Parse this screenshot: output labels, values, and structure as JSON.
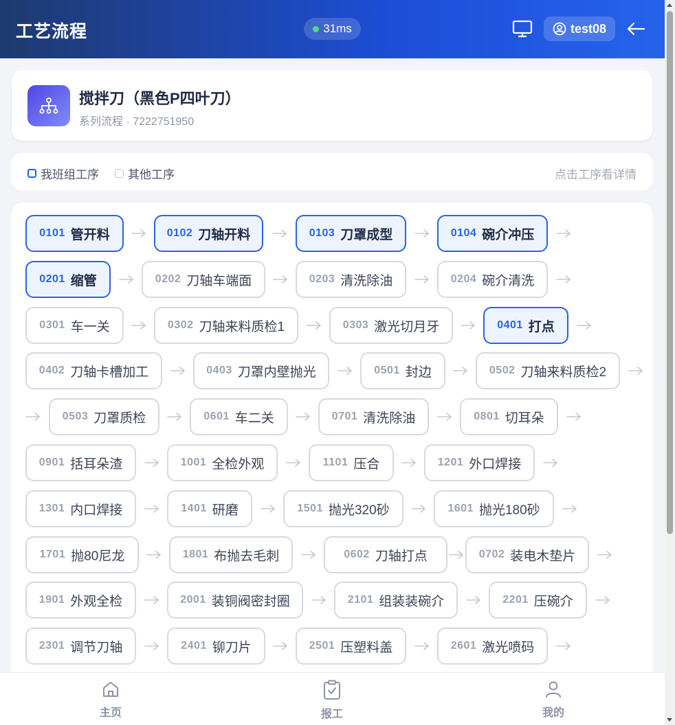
{
  "header": {
    "title": "工艺流程",
    "latency": "31ms",
    "user": "test08"
  },
  "product": {
    "name": "搅拌刀（黑色P四叶刀）",
    "subtitle": "系列流程 · 7222751950"
  },
  "legend": {
    "mine": "我班组工序",
    "other": "其他工序",
    "hint": "点击工序看详情"
  },
  "colors": {
    "accent": "#2563eb",
    "mine_bg": "#eef4ff",
    "other_border": "#d6d9e1",
    "latency_dot": "#4ade80"
  },
  "flow": [
    {
      "code": "0101",
      "name": "管开料",
      "mine": true
    },
    {
      "code": "0102",
      "name": "刀轴开料",
      "mine": true
    },
    {
      "code": "0103",
      "name": "刀罩成型",
      "mine": true
    },
    {
      "code": "0104",
      "name": "碗介冲压",
      "mine": true
    },
    {
      "code": "0201",
      "name": "缩管",
      "mine": true
    },
    {
      "code": "0202",
      "name": "刀轴车端面",
      "mine": false
    },
    {
      "code": "0203",
      "name": "清洗除油",
      "mine": false
    },
    {
      "code": "0204",
      "name": "碗介清洗",
      "mine": false
    },
    {
      "code": "0301",
      "name": "车一关",
      "mine": false
    },
    {
      "code": "0302",
      "name": "刀轴来料质检1",
      "mine": false
    },
    {
      "code": "0303",
      "name": "激光切月牙",
      "mine": false
    },
    {
      "code": "0401",
      "name": "打点",
      "mine": true
    },
    {
      "code": "0402",
      "name": "刀轴卡槽加工",
      "mine": false
    },
    {
      "code": "0403",
      "name": "刀罩内壁抛光",
      "mine": false
    },
    {
      "code": "0501",
      "name": "封边",
      "mine": false
    },
    {
      "code": "0502",
      "name": "刀轴来料质检2",
      "mine": false
    },
    {
      "code": "0503",
      "name": "刀罩质检",
      "mine": false
    },
    {
      "code": "0601",
      "name": "车二关",
      "mine": false
    },
    {
      "code": "0701",
      "name": "清洗除油",
      "mine": false
    },
    {
      "code": "0801",
      "name": "切耳朵",
      "mine": false
    },
    {
      "code": "0901",
      "name": "括耳朵渣",
      "mine": false
    },
    {
      "code": "1001",
      "name": "全检外观",
      "mine": false
    },
    {
      "code": "1101",
      "name": "压合",
      "mine": false
    },
    {
      "code": "1201",
      "name": "外口焊接",
      "mine": false
    },
    {
      "code": "1301",
      "name": "内口焊接",
      "mine": false
    },
    {
      "code": "1401",
      "name": "研磨",
      "mine": false
    },
    {
      "code": "1501",
      "name": "抛光320砂",
      "mine": false
    },
    {
      "code": "1601",
      "name": "抛光180砂",
      "mine": false
    },
    {
      "code": "1701",
      "name": "抛80尼龙",
      "mine": false
    },
    {
      "code": "1801",
      "name": "布抛去毛刺",
      "mine": false
    },
    {
      "code": "0602",
      "name": "刀轴打点",
      "mine": false
    },
    {
      "code": "0702",
      "name": "装电木垫片",
      "mine": false
    },
    {
      "code": "1901",
      "name": "外观全检",
      "mine": false
    },
    {
      "code": "2001",
      "name": "装铜阀密封圈",
      "mine": false
    },
    {
      "code": "2101",
      "name": "组装装碗介",
      "mine": false
    },
    {
      "code": "2201",
      "name": "压碗介",
      "mine": false
    },
    {
      "code": "2301",
      "name": "调节刀轴",
      "mine": false
    },
    {
      "code": "2401",
      "name": "铆刀片",
      "mine": false
    },
    {
      "code": "2501",
      "name": "压塑料盖",
      "mine": false
    },
    {
      "code": "2601",
      "name": "激光喷码",
      "mine": false
    }
  ],
  "nav": {
    "home": "主页",
    "report": "报工",
    "mine": "我的"
  }
}
